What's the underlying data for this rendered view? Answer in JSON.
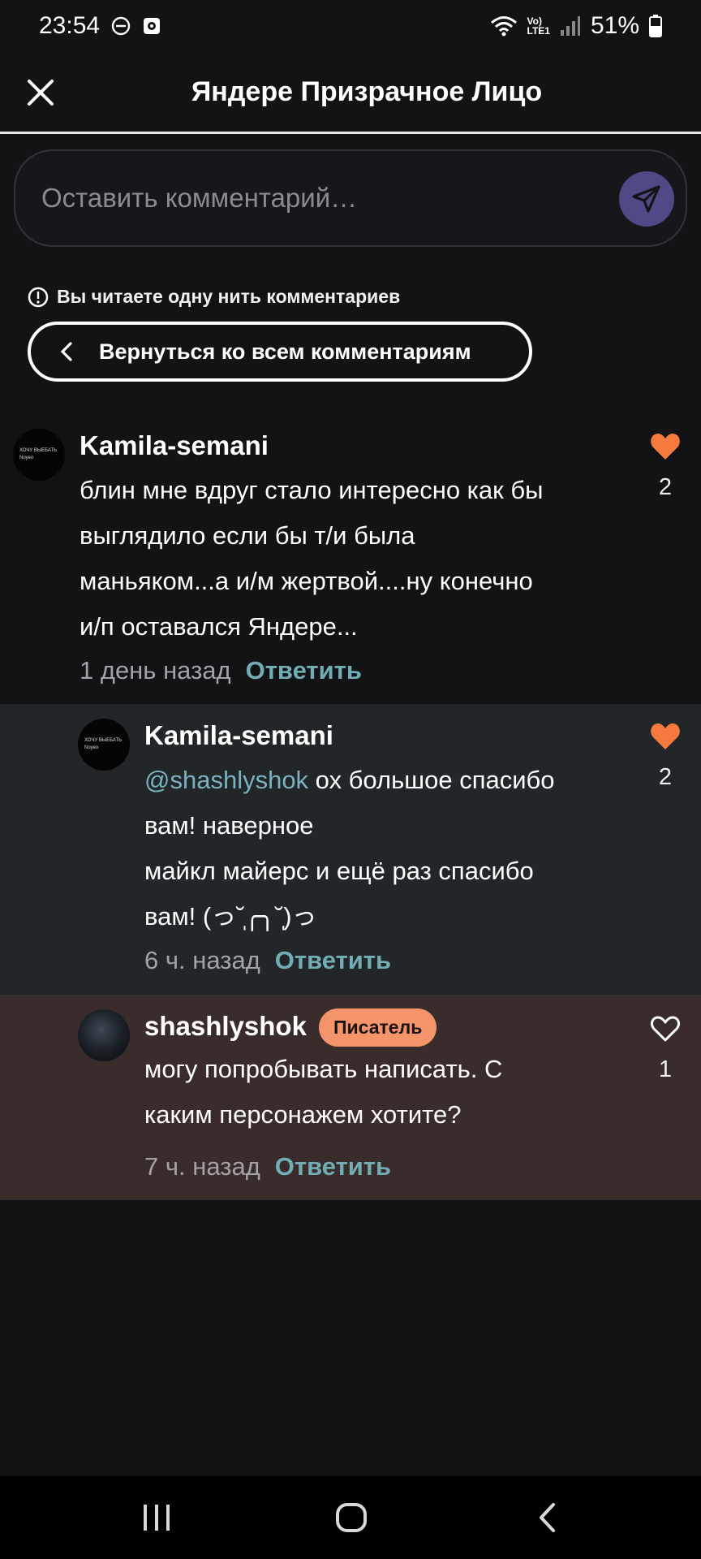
{
  "status_bar": {
    "time": "23:54",
    "network_label_top": "Vo)",
    "network_label_bottom": "LTE1",
    "battery": "51%"
  },
  "header": {
    "title": "Яндере Призрачное Лицо"
  },
  "comment_input": {
    "placeholder": "Оставить комментарий…"
  },
  "thread": {
    "notice": "Вы читаете одну нить комментариев",
    "back_button": "Вернуться ко всем комментариям"
  },
  "comments": [
    {
      "author": "Kamila-semani",
      "avatar_line1": "ХОЧУ ВЫЕБАТЬ",
      "avatar_line2": "Noyeo",
      "text_lines": [
        "блин мне вдруг стало интересно как бы",
        "выглядило если бы т/и была",
        "маньяком...а и/м жертвой....ну конечно",
        "и/п оставался Яндере..."
      ],
      "time": "1 день назад",
      "reply": "Ответить",
      "likes": "2",
      "liked": true
    },
    {
      "author": "Kamila-semani",
      "avatar_line1": "ХОЧУ ВЫЕБАТЬ",
      "avatar_line2": "Noyeo",
      "mention": "@shashlyshok",
      "text_line1_rest": " ох большое спасибо",
      "text_lines": [
        "вам! наверное",
        "майкл майерс и ещё раз спасибо",
        "вам! (っ˘̩╭╮˘̩)っ"
      ],
      "time": "6 ч. назад",
      "reply": "Ответить",
      "likes": "2",
      "liked": true
    },
    {
      "author": "shashlyshok",
      "badge": "Писатель",
      "text_lines": [
        "могу попробывать написать. С",
        "каким персонажем хотите?"
      ],
      "time": "7 ч. назад",
      "reply": "Ответить",
      "likes": "1",
      "liked": false
    }
  ],
  "colors": {
    "background": "#131215",
    "like_active": "#f47a3d",
    "reply_link": "#72adb6",
    "mention": "#7ab3c0",
    "writer_badge": "#f3946b",
    "send_button": "#4f4a86"
  }
}
